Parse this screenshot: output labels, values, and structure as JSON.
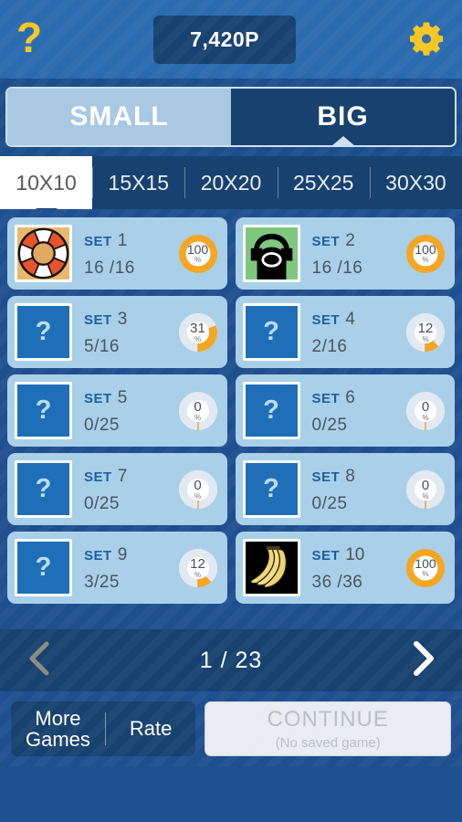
{
  "header": {
    "help_icon": "question-mark-icon",
    "points": "7,420P",
    "settings_icon": "gear-icon"
  },
  "mode_tabs": {
    "small_label": "SMALL",
    "big_label": "BIG",
    "active": "BIG"
  },
  "size_tabs": {
    "items": [
      {
        "label": "10X10",
        "active": true
      },
      {
        "label": "15X15",
        "active": false
      },
      {
        "label": "20X20",
        "active": false
      },
      {
        "label": "25X25",
        "active": false
      },
      {
        "label": "30X30",
        "active": false
      }
    ]
  },
  "sets": [
    {
      "set_word": "SET",
      "number": "1",
      "progress": "16 /16",
      "percent": 100,
      "percent_label": "100",
      "pct_symbol": "%",
      "locked": false,
      "thumb": "lifebuoy-icon"
    },
    {
      "set_word": "SET",
      "number": "2",
      "progress": "16 /16",
      "percent": 100,
      "percent_label": "100",
      "pct_symbol": "%",
      "locked": false,
      "thumb": "telephone-icon"
    },
    {
      "set_word": "SET",
      "number": "3",
      "progress": "5/16",
      "percent": 31,
      "percent_label": "31",
      "pct_symbol": "%",
      "locked": true,
      "thumb": "question-mark-icon"
    },
    {
      "set_word": "SET",
      "number": "4",
      "progress": "2/16",
      "percent": 12,
      "percent_label": "12",
      "pct_symbol": "%",
      "locked": true,
      "thumb": "question-mark-icon"
    },
    {
      "set_word": "SET",
      "number": "5",
      "progress": "0/25",
      "percent": 0,
      "percent_label": "0",
      "pct_symbol": "%",
      "locked": true,
      "thumb": "question-mark-icon"
    },
    {
      "set_word": "SET",
      "number": "6",
      "progress": "0/25",
      "percent": 0,
      "percent_label": "0",
      "pct_symbol": "%",
      "locked": true,
      "thumb": "question-mark-icon"
    },
    {
      "set_word": "SET",
      "number": "7",
      "progress": "0/25",
      "percent": 0,
      "percent_label": "0",
      "pct_symbol": "%",
      "locked": true,
      "thumb": "question-mark-icon"
    },
    {
      "set_word": "SET",
      "number": "8",
      "progress": "0/25",
      "percent": 0,
      "percent_label": "0",
      "pct_symbol": "%",
      "locked": true,
      "thumb": "question-mark-icon"
    },
    {
      "set_word": "SET",
      "number": "9",
      "progress": "3/25",
      "percent": 12,
      "percent_label": "12",
      "pct_symbol": "%",
      "locked": true,
      "thumb": "question-mark-icon"
    },
    {
      "set_word": "SET",
      "number": "10",
      "progress": "36 /36",
      "percent": 100,
      "percent_label": "100",
      "pct_symbol": "%",
      "locked": false,
      "thumb": "bananas-icon"
    }
  ],
  "pager": {
    "prev_icon": "chevron-left-icon",
    "next_icon": "chevron-right-icon",
    "label": "1 / 23",
    "prev_enabled": false,
    "next_enabled": true
  },
  "bottom": {
    "more_games_line1": "More",
    "more_games_line2": "Games",
    "rate_label": "Rate",
    "continue_label": "CONTINUE",
    "continue_sub": "(No saved game)",
    "continue_enabled": false
  },
  "colors": {
    "background": "#1f4f8f",
    "header": "#2a6aae",
    "panel_dark": "#17416f",
    "card": "#a9d0e8",
    "accent_yellow": "#f5c624",
    "accent_orange": "#f5a623",
    "set_label_blue": "#1e5fa8"
  }
}
